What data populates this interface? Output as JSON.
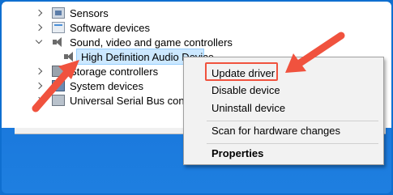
{
  "tree": {
    "items": [
      {
        "label": "Sensors",
        "icon": "sensor-icon",
        "expanded": false
      },
      {
        "label": "Software devices",
        "icon": "software-icon",
        "expanded": false
      },
      {
        "label": "Sound, video and game controllers",
        "icon": "speaker-icon",
        "expanded": true
      },
      {
        "label": "High Definition Audio Device",
        "icon": "speaker-icon",
        "selected": true
      },
      {
        "label": "Storage controllers",
        "icon": "storage-icon",
        "expanded": false
      },
      {
        "label": "System devices",
        "icon": "system-icon",
        "expanded": false
      },
      {
        "label": "Universal Serial Bus controllers",
        "icon": "usb-icon",
        "expanded": false
      }
    ]
  },
  "context_menu": {
    "items": [
      {
        "label": "Update driver",
        "highlighted": true
      },
      {
        "label": "Disable device"
      },
      {
        "label": "Uninstall device"
      },
      {
        "label": "Scan for hardware changes"
      },
      {
        "label": "Properties",
        "bold": true
      }
    ]
  },
  "annotation": {
    "color": "#f0523e"
  }
}
